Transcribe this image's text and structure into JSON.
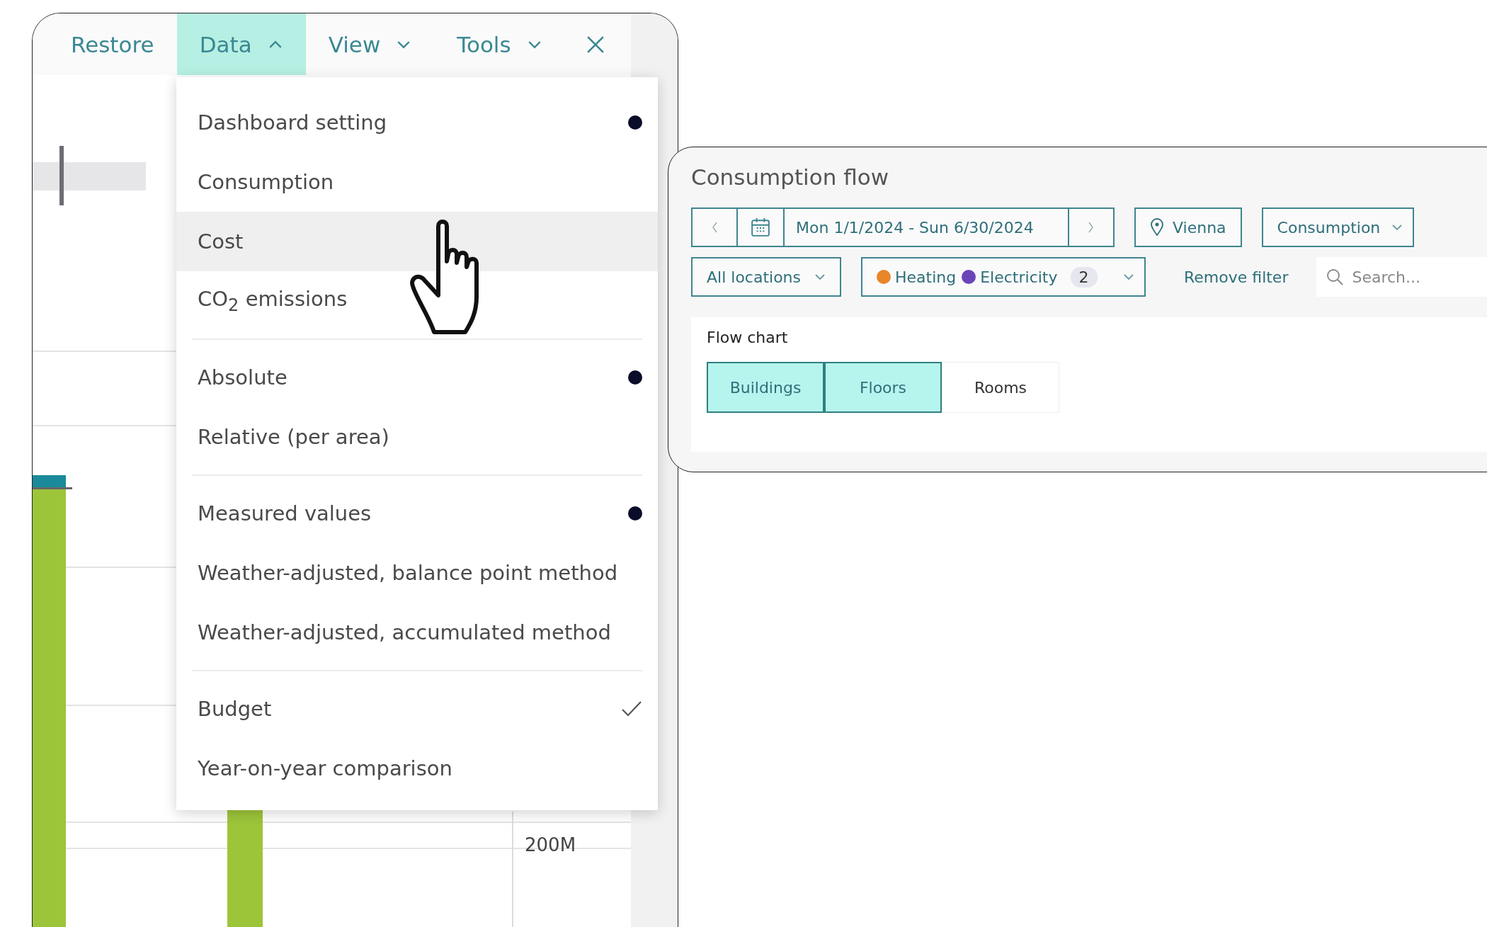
{
  "toolbar": {
    "items": [
      {
        "label": "Restore",
        "kind": "button",
        "selected": false
      },
      {
        "label": "Data",
        "kind": "menu",
        "selected": true,
        "expanded": true
      },
      {
        "label": "View",
        "kind": "menu",
        "selected": false,
        "expanded": false
      },
      {
        "label": "Tools",
        "kind": "menu",
        "selected": false,
        "expanded": false
      }
    ]
  },
  "chart_background": {
    "axis_label": "200M"
  },
  "data_menu": {
    "groups": [
      {
        "kind": "radio",
        "items": [
          {
            "label": "Dashboard setting",
            "selected": true,
            "hovered": false
          },
          {
            "label": "Consumption",
            "selected": false,
            "hovered": false
          },
          {
            "label": "Cost",
            "selected": false,
            "hovered": true
          },
          {
            "label": "CO$_{2}$ emissions",
            "selected": false,
            "hovered": false
          }
        ]
      },
      {
        "kind": "radio",
        "items": [
          {
            "label": "Absolute",
            "selected": true,
            "hovered": false
          },
          {
            "label": "Relative (per area)",
            "selected": false,
            "hovered": false
          }
        ]
      },
      {
        "kind": "radio",
        "items": [
          {
            "label": "Measured values",
            "selected": true,
            "hovered": false
          },
          {
            "label": "Weather-adjusted, balance point method",
            "selected": false,
            "hovered": false
          },
          {
            "label": "Weather-adjusted, accumulated method",
            "selected": false,
            "hovered": false
          }
        ]
      },
      {
        "kind": "checkbox",
        "items": [
          {
            "label": "Budget",
            "checked": true,
            "hovered": false
          },
          {
            "label": "Year-on-year comparison",
            "checked": false,
            "hovered": false
          }
        ]
      }
    ]
  },
  "flow_panel": {
    "title": "Consumption flow",
    "date_range": "Mon 1/1/2024 - Sun 6/30/2024",
    "location": "Vienna",
    "measure": "Consumption",
    "location_filter": "All locations",
    "media_filter": {
      "chips": [
        {
          "label": "Heating",
          "color": "#e8862a"
        },
        {
          "label": "Electricity",
          "color": "#6b45b8"
        }
      ],
      "count": "2"
    },
    "remove_filter": "Remove filter",
    "search": {
      "placeholder": "Search..."
    },
    "section_title": "Flow chart",
    "levels": [
      {
        "label": "Buildings",
        "selected": true
      },
      {
        "label": "Floors",
        "selected": true
      },
      {
        "label": "Rooms",
        "selected": false
      }
    ]
  }
}
